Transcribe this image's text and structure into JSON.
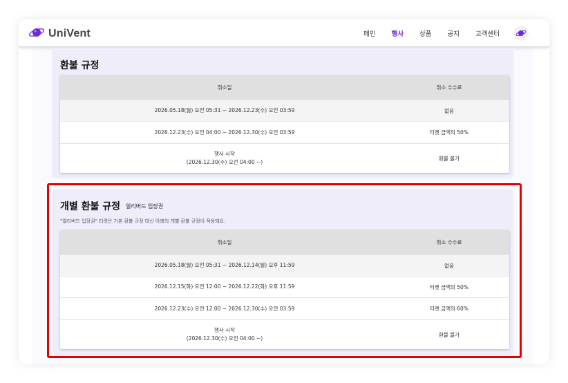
{
  "app": {
    "logo_text": "UniVent"
  },
  "nav": {
    "items": [
      {
        "label": "메인"
      },
      {
        "label": "행사"
      },
      {
        "label": "상품"
      },
      {
        "label": "공지"
      },
      {
        "label": "고객센터"
      }
    ],
    "active_index": 1
  },
  "refund_policy": {
    "title": "환불 규정",
    "headers": {
      "date": "취소일",
      "fee": "취소 수수료"
    },
    "rows": [
      {
        "date": "2026.05.18(월) 오전 05:31 ~ 2026.12.23(수) 오전 03:59",
        "fee": "없음"
      },
      {
        "date": "2026.12.23(수) 오전 04:00 ~ 2026.12.30(수) 오전 03:59",
        "fee": "티켓 금액의 50%"
      },
      {
        "date_line1": "행사 시작",
        "date_line2": "(2026.12.30(수) 오전 04:00 ~)",
        "fee": "환불 불가"
      }
    ]
  },
  "individual_policy": {
    "title": "개별 환불 규정",
    "badge": "얼리버드 입장권",
    "description": "\"얼리버드 입장권\" 티켓은 기본 환불 규정 대신 아래의 개별 환불 규정이 적용돼요.",
    "headers": {
      "date": "취소일",
      "fee": "취소 수수료"
    },
    "rows": [
      {
        "date": "2026.05.18(월) 오전 05:31 ~ 2026.12.14(월) 오후 11:59",
        "fee": "없음"
      },
      {
        "date": "2026.12.15(화) 오전 12:00 ~ 2026.12.22(화) 오후 11:59",
        "fee": "티켓 금액의 50%"
      },
      {
        "date": "2026.12.23(수) 오전 12:00 ~ 2026.12.30(수) 오전 03:59",
        "fee": "티켓 금액의 60%"
      },
      {
        "date_line1": "행사 시작",
        "date_line2": "(2026.12.30(수) 오전 04:00 ~)",
        "fee": "환불 불가"
      }
    ]
  },
  "colors": {
    "brand": "#6a2bd6",
    "highlight": "#e40000"
  }
}
